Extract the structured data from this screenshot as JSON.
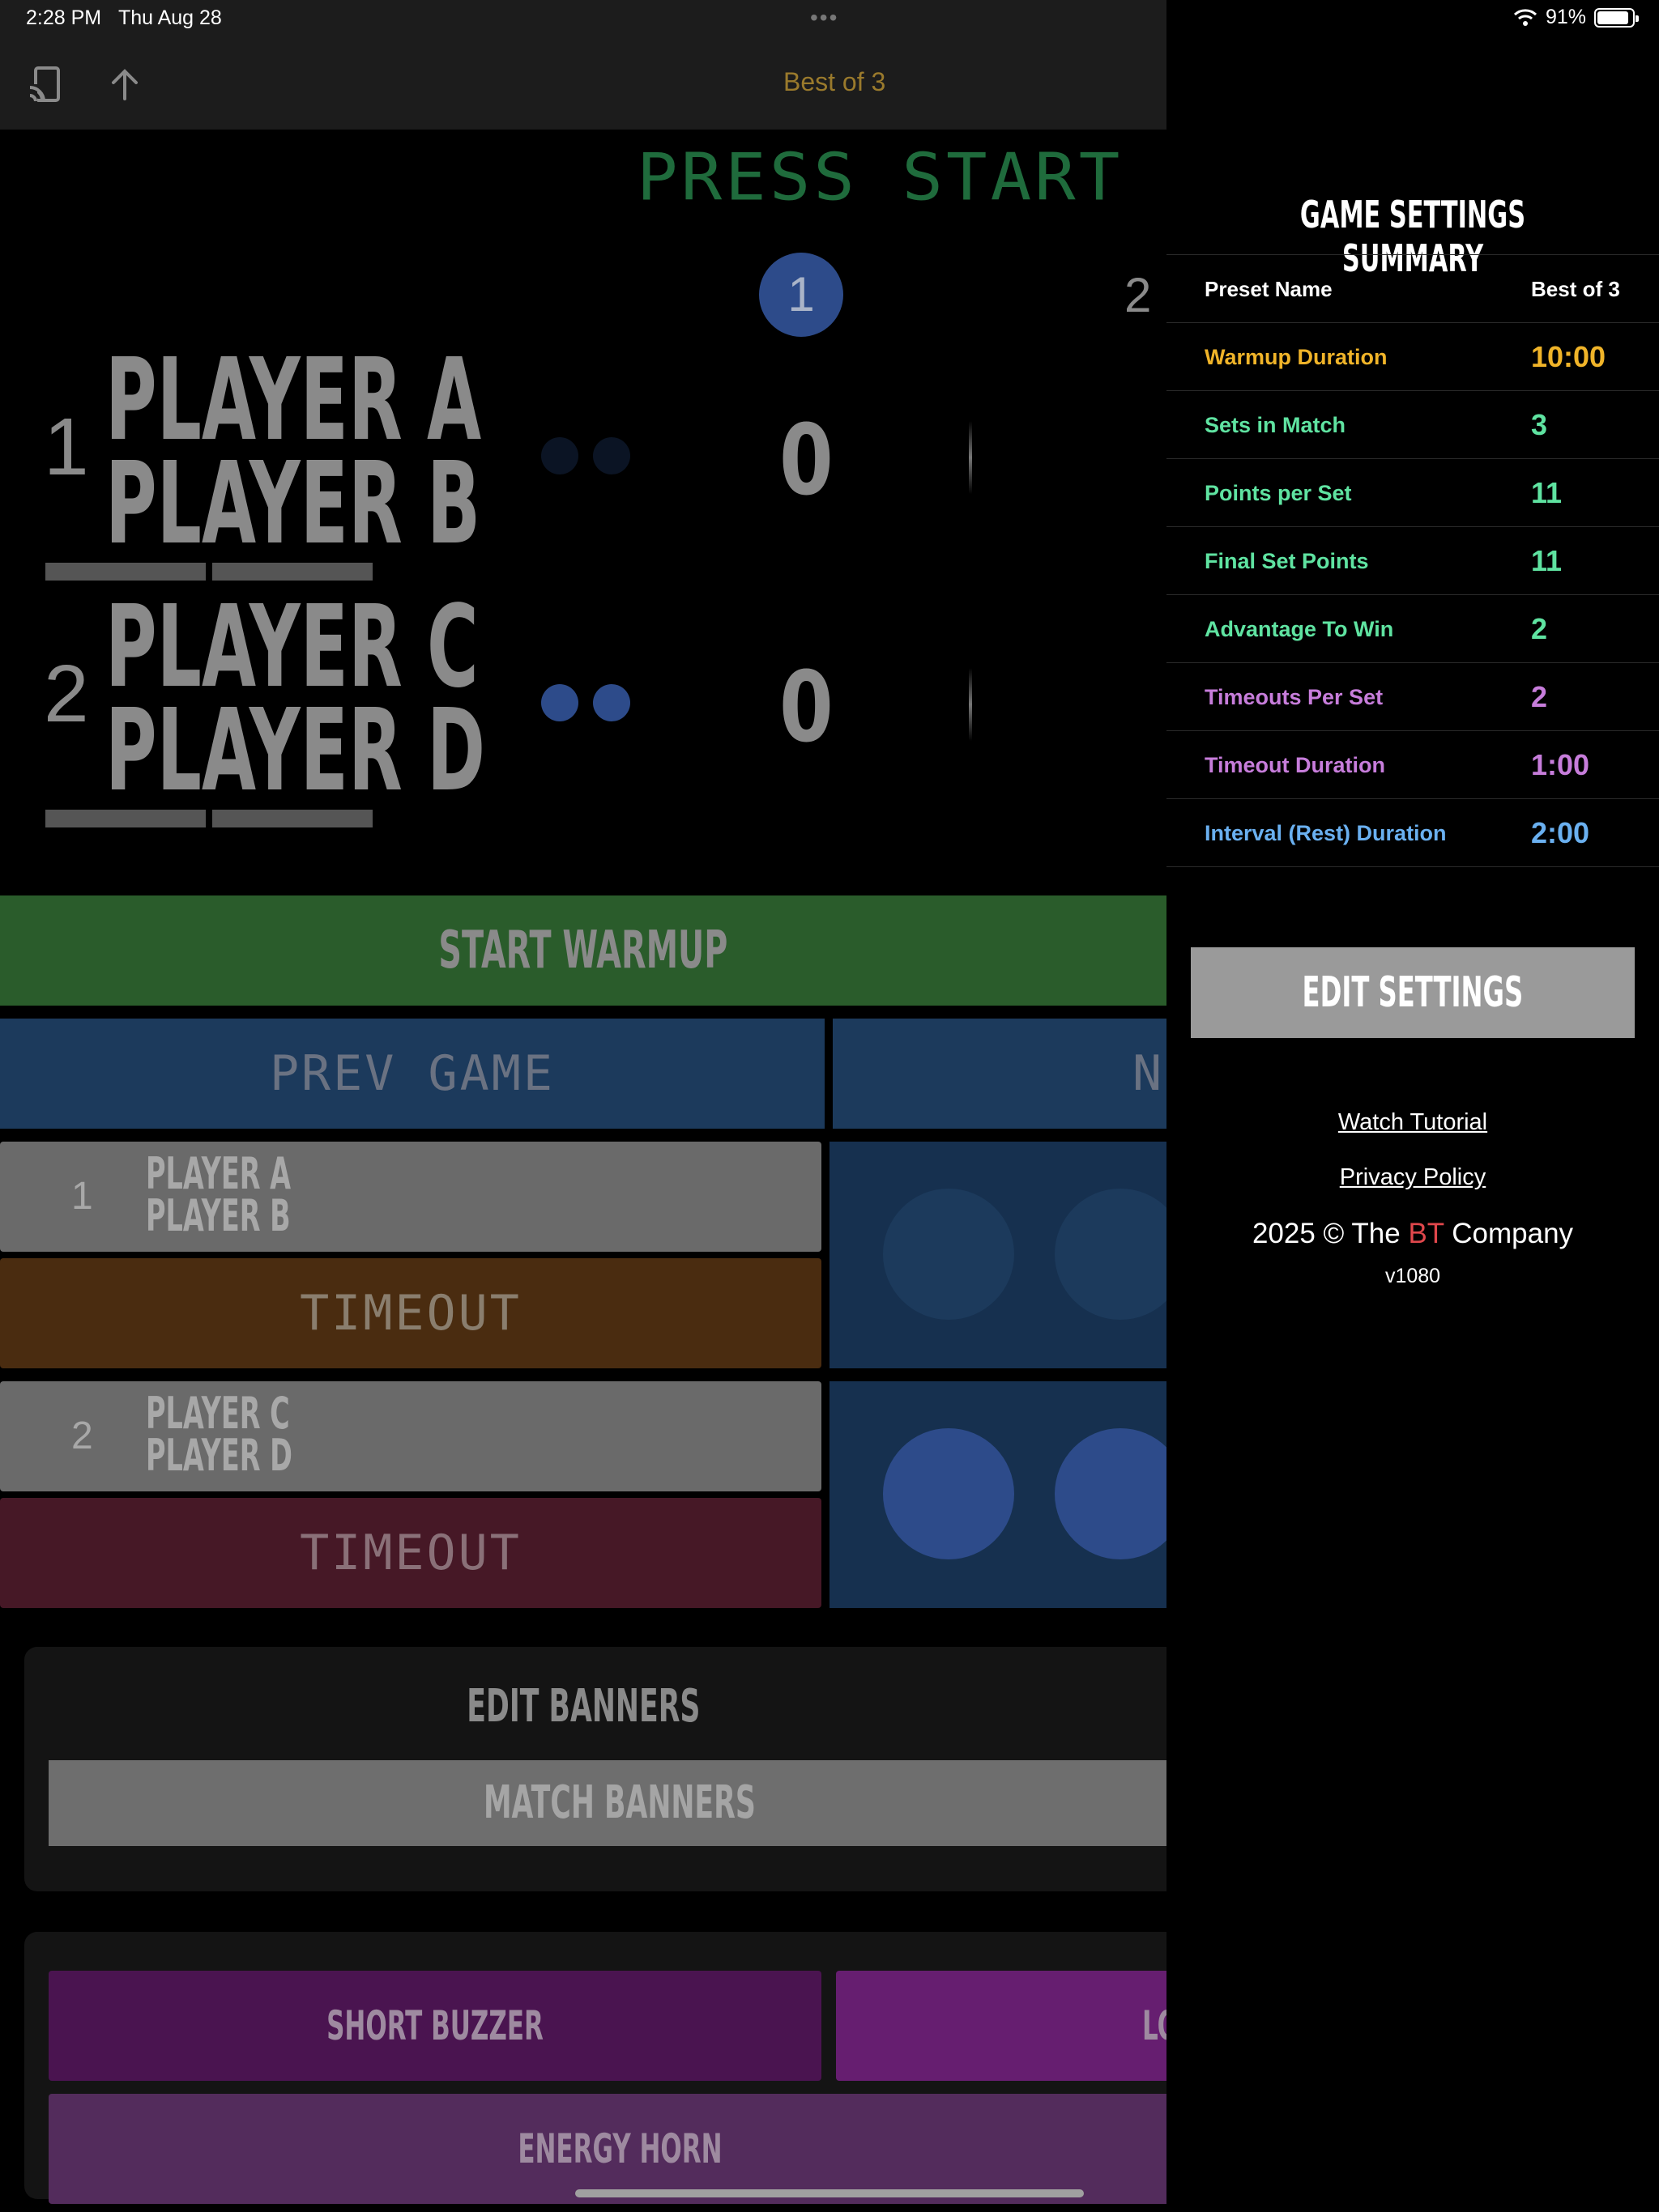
{
  "status_bar": {
    "time": "2:28 PM",
    "date": "Thu Aug 28",
    "dots": "•••",
    "battery": "91%",
    "battery_level": 0.91
  },
  "navbar": {
    "title": "Best of 3"
  },
  "scoreboard": {
    "message": "PRESS START",
    "current_set": "1",
    "next_set": "2",
    "teams": [
      {
        "number": "1",
        "player1": "PLAYER A",
        "player2": "PLAYER B",
        "score": "0",
        "serve_color": "#0b1424"
      },
      {
        "number": "2",
        "player1": "PLAYER C",
        "player2": "PLAYER D",
        "score": "0",
        "serve_color": "#2d4b8a"
      }
    ]
  },
  "controls": {
    "start_warmup": "START WARMUP",
    "prev_game": "PREV GAME",
    "next_game_partial": "NE",
    "timeout_label": "TIMEOUT",
    "team_rows": [
      {
        "number": "1",
        "player1": "PLAYER A",
        "player2": "PLAYER B",
        "timeout_color": "#4a2c10"
      },
      {
        "number": "2",
        "player1": "PLAYER C",
        "player2": "PLAYER D",
        "timeout_color": "#461826"
      }
    ]
  },
  "banners": {
    "title": "EDIT BANNERS",
    "match_banners": "MATCH BANNERS"
  },
  "sounds": {
    "short_buzzer": "SHORT BUZZER",
    "long_partial": "LO",
    "energy_horn": "ENERGY HORN"
  },
  "sidebar": {
    "title": "GAME SETTINGS SUMMARY",
    "rows": [
      {
        "label": "Preset Name",
        "value": "Best of 3",
        "color": "#ffffff"
      },
      {
        "label": "Warmup Duration",
        "value": "10:00",
        "color": "#f0b429"
      },
      {
        "label": "Sets in Match",
        "value": "3",
        "color": "#5fe3a1"
      },
      {
        "label": "Points per Set",
        "value": "11",
        "color": "#5fe3a1"
      },
      {
        "label": "Final Set Points",
        "value": "11",
        "color": "#5fe3a1"
      },
      {
        "label": "Advantage To Win",
        "value": "2",
        "color": "#5fe3a1"
      },
      {
        "label": "Timeouts Per Set",
        "value": "2",
        "color": "#c77ddb"
      },
      {
        "label": "Timeout Duration",
        "value": "1:00",
        "color": "#c77ddb"
      },
      {
        "label": "Interval (Rest) Duration",
        "value": "2:00",
        "color": "#6ab0f0"
      }
    ],
    "edit_button": "EDIT SETTINGS",
    "watch_tutorial": "Watch Tutorial",
    "privacy_policy": "Privacy Policy",
    "copyright_prefix": "2025 © The ",
    "copyright_brand": "BT",
    "copyright_suffix": " Company",
    "brand_color": "#e0474c",
    "version": "v1080"
  }
}
